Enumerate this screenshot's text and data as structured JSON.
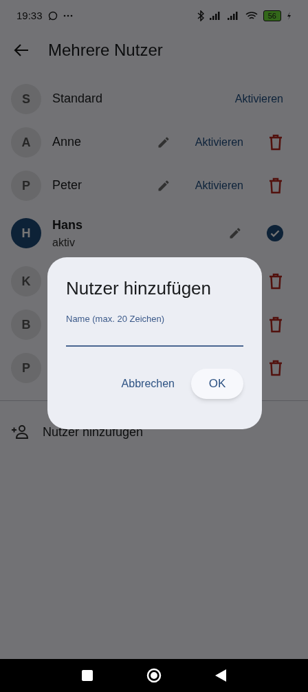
{
  "status_bar": {
    "time": "19:33",
    "battery": "56"
  },
  "header": {
    "title": "Mehrere Nutzer"
  },
  "users": [
    {
      "avatar": "S",
      "name": "Standard",
      "editable": false,
      "action": "Aktivieren",
      "active": false,
      "deletable": false
    },
    {
      "avatar": "A",
      "name": "Anne",
      "editable": true,
      "action": "Aktivieren",
      "active": false,
      "deletable": true
    },
    {
      "avatar": "P",
      "name": "Peter",
      "editable": true,
      "action": "Aktivieren",
      "active": false,
      "deletable": true
    },
    {
      "avatar": "H",
      "name": "Hans",
      "subtitle": "aktiv",
      "editable": true,
      "active": true,
      "deletable": false
    },
    {
      "avatar": "K",
      "active": false,
      "deletable": true
    },
    {
      "avatar": "B",
      "active": false,
      "deletable": true
    },
    {
      "avatar": "P",
      "active": false,
      "deletable": true
    }
  ],
  "add_user": {
    "label": "Nutzer hinzufügen"
  },
  "dialog": {
    "title": "Nutzer hinzufügen",
    "field_label": "Name (max. 20 Zeichen)",
    "buttons": [
      {
        "label": "Abbrechen",
        "kind": "text"
      },
      {
        "label": "OK",
        "kind": "filled"
      }
    ]
  }
}
